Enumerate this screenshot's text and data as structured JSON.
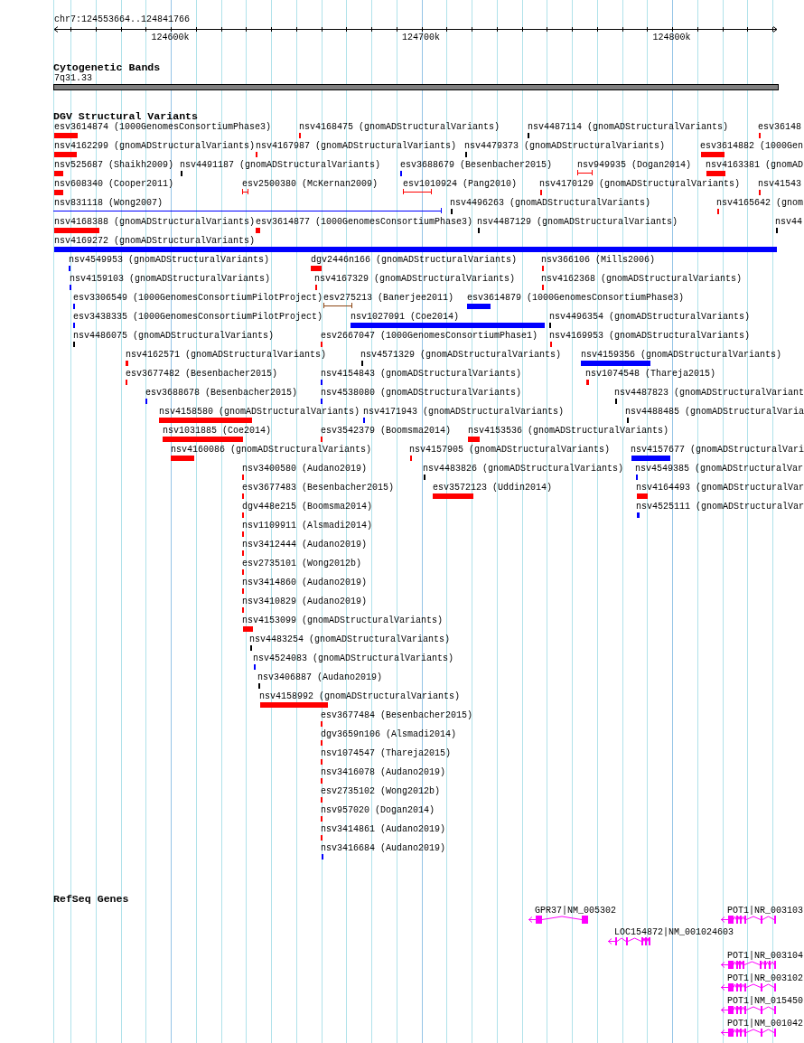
{
  "locus": {
    "label": "chr7:124553664..124841766"
  },
  "ruler": {
    "ticks": [
      "124600k",
      "124700k",
      "124800k"
    ]
  },
  "tracks": [
    {
      "kind": "bands",
      "title": "Cytogenetic Bands",
      "bands": [
        {
          "name": "7q31.33"
        }
      ]
    },
    {
      "kind": "variants",
      "title": "DGV Structural Variants",
      "features": [
        {
          "label": "esv3614874 (1000GenomesConsortiumPhase3)",
          "color": "#ff0000",
          "kind": "box"
        },
        {
          "label": "nsv4168475 (gnomADStructuralVariants)",
          "color": "#ff0000",
          "kind": "box"
        },
        {
          "label": "nsv4487114 (gnomADStructuralVariants)",
          "color": "#000000",
          "kind": "box"
        },
        {
          "label": "esv36148",
          "color": "#ff0000",
          "kind": "box"
        },
        {
          "label": "nsv4162299 (gnomADStructuralVariants)",
          "color": "#ff0000",
          "kind": "box"
        },
        {
          "label": "nsv4167987 (gnomADStructuralVariants)",
          "color": "#ff0000",
          "kind": "box"
        },
        {
          "label": "nsv4479373 (gnomADStructuralVariants)",
          "color": "#000000",
          "kind": "box"
        },
        {
          "label": "esv3614882 (1000Gen",
          "color": "#ff0000",
          "kind": "box"
        },
        {
          "label": "nsv525687 (Shaikh2009)",
          "color": "#ff0000",
          "kind": "box"
        },
        {
          "label": "nsv4491187 (gnomADStructuralVariants)",
          "color": "#000000",
          "kind": "box"
        },
        {
          "label": "esv3688679 (Besenbacher2015)",
          "color": "#0000ff",
          "kind": "box"
        },
        {
          "label": "nsv949935 (Dogan2014)",
          "color": "#ff0000",
          "kind": "span"
        },
        {
          "label": "nsv4163381 (gnomAD",
          "color": "#ff0000",
          "kind": "box"
        },
        {
          "label": "nsv608340 (Cooper2011)",
          "color": "#ff0000",
          "kind": "box"
        },
        {
          "label": "esv2500380 (McKernan2009)",
          "color": "#ff0000",
          "kind": "span"
        },
        {
          "label": "esv1010924 (Pang2010)",
          "color": "#ff0000",
          "kind": "span"
        },
        {
          "label": "nsv4170129 (gnomADStructuralVariants)",
          "color": "#ff0000",
          "kind": "box"
        },
        {
          "label": "nsv41543",
          "color": "#ff0000",
          "kind": "box"
        },
        {
          "label": "nsv831118 (Wong2007)",
          "color": "#0000ff",
          "kind": "span"
        },
        {
          "label": "nsv4496263 (gnomADStructuralVariants)",
          "color": "#000000",
          "kind": "box"
        },
        {
          "label": "nsv4165642 (gnom",
          "color": "#ff0000",
          "kind": "box"
        },
        {
          "label": "nsv4168388 (gnomADStructuralVariants)",
          "color": "#ff0000",
          "kind": "box"
        },
        {
          "label": "esv3614877 (1000GenomesConsortiumPhase3)",
          "color": "#ff0000",
          "kind": "box"
        },
        {
          "label": "nsv4487129 (gnomADStructuralVariants)",
          "color": "#000000",
          "kind": "box"
        },
        {
          "label": "nsv44",
          "color": "#000000",
          "kind": "box"
        },
        {
          "label": "nsv4169272 (gnomADStructuralVariants)",
          "color": "#0000ff",
          "kind": "box"
        },
        {
          "label": "nsv4549953 (gnomADStructuralVariants)",
          "color": "#0000ff",
          "kind": "box"
        },
        {
          "label": "dgv2446n166 (gnomADStructuralVariants)",
          "color": "#ff0000",
          "kind": "box"
        },
        {
          "label": "nsv366106 (Mills2006)",
          "color": "#ff0000",
          "kind": "box"
        },
        {
          "label": "nsv4159103 (gnomADStructuralVariants)",
          "color": "#0000ff",
          "kind": "box"
        },
        {
          "label": "nsv4167329 (gnomADStructuralVariants)",
          "color": "#ff0000",
          "kind": "box"
        },
        {
          "label": "nsv4162368 (gnomADStructuralVariants)",
          "color": "#ff0000",
          "kind": "box"
        },
        {
          "label": "esv3306549 (1000GenomesConsortiumPilotProject)",
          "color": "#0000ff",
          "kind": "box"
        },
        {
          "label": "esv275213 (Banerjee2011)",
          "color": "#8b4513",
          "kind": "span"
        },
        {
          "label": "esv3614879 (1000GenomesConsortiumPhase3)",
          "color": "#0000ff",
          "kind": "box"
        },
        {
          "label": "esv3438335 (1000GenomesConsortiumPilotProject)",
          "color": "#0000ff",
          "kind": "box"
        },
        {
          "label": "nsv1027091 (Coe2014)",
          "color": "#0000ff",
          "kind": "box"
        },
        {
          "label": "nsv4496354 (gnomADStructuralVariants)",
          "color": "#000000",
          "kind": "box"
        },
        {
          "label": "nsv4486075 (gnomADStructuralVariants)",
          "color": "#000000",
          "kind": "box"
        },
        {
          "label": "esv2667047 (1000GenomesConsortiumPhase1)",
          "color": "#ff0000",
          "kind": "box"
        },
        {
          "label": "nsv4169953 (gnomADStructuralVariants)",
          "color": "#ff0000",
          "kind": "box"
        },
        {
          "label": "nsv4162571 (gnomADStructuralVariants)",
          "color": "#ff0000",
          "kind": "box"
        },
        {
          "label": "nsv4571329 (gnomADStructuralVariants)",
          "color": "#000000",
          "kind": "box"
        },
        {
          "label": "nsv4159356 (gnomADStructuralVariants)",
          "color": "#0000ff",
          "kind": "box"
        },
        {
          "label": "esv3677482 (Besenbacher2015)",
          "color": "#ff0000",
          "kind": "box"
        },
        {
          "label": "nsv4154843 (gnomADStructuralVariants)",
          "color": "#0000ff",
          "kind": "box"
        },
        {
          "label": "nsv1074548 (Thareja2015)",
          "color": "#ff0000",
          "kind": "box"
        },
        {
          "label": "esv3688678 (Besenbacher2015)",
          "color": "#0000ff",
          "kind": "box"
        },
        {
          "label": "nsv4538080 (gnomADStructuralVariants)",
          "color": "#0000ff",
          "kind": "box"
        },
        {
          "label": "nsv4487823 (gnomADStructuralVariant",
          "color": "#000000",
          "kind": "box"
        },
        {
          "label": "nsv4158580 (gnomADStructuralVariants)",
          "color": "#ff0000",
          "kind": "box"
        },
        {
          "label": "nsv4171943 (gnomADStructuralVariants)",
          "color": "#0000ff",
          "kind": "box"
        },
        {
          "label": "nsv4488485 (gnomADStructuralVaria",
          "color": "#000000",
          "kind": "box"
        },
        {
          "label": "nsv1031885 (Coe2014)",
          "color": "#ff0000",
          "kind": "box"
        },
        {
          "label": "esv3542379 (Boomsma2014)",
          "color": "#ff0000",
          "kind": "box"
        },
        {
          "label": "nsv4153536 (gnomADStructuralVariants)",
          "color": "#ff0000",
          "kind": "box"
        },
        {
          "label": "nsv4160086 (gnomADStructuralVariants)",
          "color": "#ff0000",
          "kind": "box"
        },
        {
          "label": "nsv4157905 (gnomADStructuralVariants)",
          "color": "#ff0000",
          "kind": "box"
        },
        {
          "label": "nsv4157677 (gnomADStructuralVari",
          "color": "#0000ff",
          "kind": "box"
        },
        {
          "label": "nsv3400580 (Audano2019)",
          "color": "#ff0000",
          "kind": "box"
        },
        {
          "label": "nsv4483826 (gnomADStructuralVariants)",
          "color": "#000000",
          "kind": "box"
        },
        {
          "label": "nsv4549385 (gnomADStructuralVar",
          "color": "#0000ff",
          "kind": "box"
        },
        {
          "label": "esv3677483 (Besenbacher2015)",
          "color": "#ff0000",
          "kind": "box"
        },
        {
          "label": "esv3572123 (Uddin2014)",
          "color": "#ff0000",
          "kind": "box"
        },
        {
          "label": "nsv4164493 (gnomADStructuralVar",
          "color": "#ff0000",
          "kind": "box"
        },
        {
          "label": "dgv448e215 (Boomsma2014)",
          "color": "#ff0000",
          "kind": "box"
        },
        {
          "label": "nsv4525111 (gnomADStructuralVar",
          "color": "#0000ff",
          "kind": "box"
        },
        {
          "label": "nsv1109911 (Alsmadi2014)",
          "color": "#ff0000",
          "kind": "box"
        },
        {
          "label": "nsv3412444 (Audano2019)",
          "color": "#ff0000",
          "kind": "box"
        },
        {
          "label": "esv2735101 (Wong2012b)",
          "color": "#ff0000",
          "kind": "box"
        },
        {
          "label": "nsv3414860 (Audano2019)",
          "color": "#ff0000",
          "kind": "box"
        },
        {
          "label": "nsv3410829 (Audano2019)",
          "color": "#ff0000",
          "kind": "box"
        },
        {
          "label": "nsv4153099 (gnomADStructuralVariants)",
          "color": "#ff0000",
          "kind": "box"
        },
        {
          "label": "nsv4483254 (gnomADStructuralVariants)",
          "color": "#000000",
          "kind": "box"
        },
        {
          "label": "nsv4524083 (gnomADStructuralVariants)",
          "color": "#0000ff",
          "kind": "box"
        },
        {
          "label": "nsv3406887 (Audano2019)",
          "color": "#000000",
          "kind": "box"
        },
        {
          "label": "nsv4158992 (gnomADStructuralVariants)",
          "color": "#ff0000",
          "kind": "box"
        },
        {
          "label": "esv3677484 (Besenbacher2015)",
          "color": "#ff0000",
          "kind": "box"
        },
        {
          "label": "dgv3659n106 (Alsmadi2014)",
          "color": "#ff0000",
          "kind": "box"
        },
        {
          "label": "nsv1074547 (Thareja2015)",
          "color": "#ff0000",
          "kind": "box"
        },
        {
          "label": "nsv3416078 (Audano2019)",
          "color": "#ff0000",
          "kind": "box"
        },
        {
          "label": "esv2735102 (Wong2012b)",
          "color": "#ff0000",
          "kind": "box"
        },
        {
          "label": "nsv957020 (Dogan2014)",
          "color": "#ff0000",
          "kind": "box"
        },
        {
          "label": "nsv3414861 (Audano2019)",
          "color": "#ff0000",
          "kind": "box"
        },
        {
          "label": "nsv3416684 (Audano2019)",
          "color": "#0000ff",
          "kind": "box"
        }
      ]
    },
    {
      "kind": "genes",
      "title": "RefSeq Genes",
      "features": [
        {
          "label": "GPR37|NM_005302",
          "reverse": true
        },
        {
          "label": "POT1|NR_003103",
          "reverse": true
        },
        {
          "label": "LOC154872|NM_001024603",
          "reverse": true
        },
        {
          "label": "POT1|NR_003104",
          "reverse": true
        },
        {
          "label": "POT1|NR_003102",
          "reverse": true
        },
        {
          "label": "POT1|NM_015450",
          "reverse": true
        },
        {
          "label": "POT1|NM_001042",
          "reverse": true
        }
      ]
    }
  ]
}
